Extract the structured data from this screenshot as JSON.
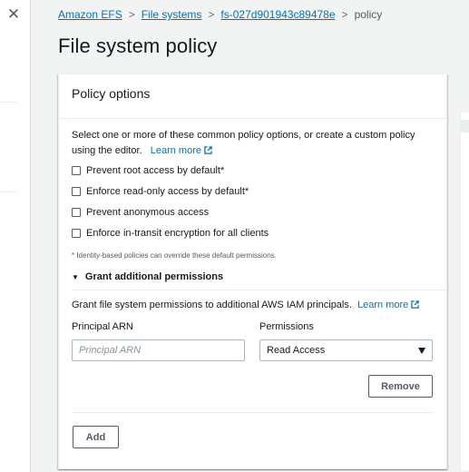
{
  "nav": {
    "close_icon": "close-icon"
  },
  "breadcrumb": {
    "items": [
      "Amazon EFS",
      "File systems",
      "fs-027d901943c89478e"
    ],
    "current": "policy",
    "separator": ">"
  },
  "page": {
    "title": "File system policy"
  },
  "policy_options": {
    "header": "Policy options",
    "description": "Select one or more of these common policy options, or create a custom policy using the editor.",
    "learn_more": "Learn more",
    "checkboxes": [
      "Prevent root access by default*",
      "Enforce read-only access by default*",
      "Prevent anonymous access",
      "Enforce in-transit encryption for all clients"
    ],
    "footnote": "* Identity-based policies can override these default permissions."
  },
  "grant": {
    "header": "Grant additional permissions",
    "description": "Grant file system permissions to additional AWS IAM principals.",
    "learn_more": "Learn more",
    "principal_label": "Principal ARN",
    "principal_placeholder": "Principal ARN",
    "permissions_label": "Permissions",
    "permissions_value": "Read Access",
    "remove_label": "Remove",
    "add_label": "Add"
  },
  "colors": {
    "link": "#0073bb",
    "text": "#16191f",
    "muted": "#545b64"
  }
}
